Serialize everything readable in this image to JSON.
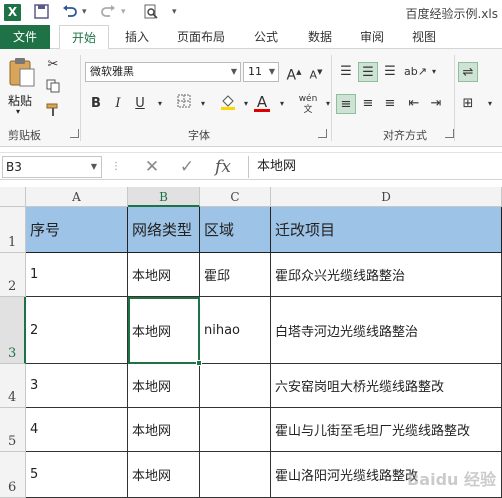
{
  "title_bar": {
    "app_logo": "X",
    "document_title": "百度经验示例.xls"
  },
  "ribbon_tabs": [
    "文件",
    "开始",
    "插入",
    "页面布局",
    "公式",
    "数据",
    "审阅",
    "视图"
  ],
  "active_tab": "开始",
  "ribbon": {
    "clipboard": {
      "paste_label": "粘贴",
      "group_label": "剪贴板"
    },
    "font": {
      "font_name": "微软雅黑",
      "font_size": "11",
      "bold": "B",
      "italic": "I",
      "underline": "U",
      "group_label": "字体",
      "grow": "A",
      "shrink": "A",
      "font_color_letter": "A",
      "phonetic": "wén"
    },
    "alignment": {
      "group_label": "对齐方式"
    }
  },
  "formula_bar": {
    "name_box": "B3",
    "fx_label": "fx",
    "formula": "本地网"
  },
  "sheet": {
    "columns": [
      "A",
      "B",
      "C",
      "D"
    ],
    "selected_column": "B",
    "selected_row": "3",
    "rows": [
      {
        "num": "1",
        "cells": [
          "序号",
          "网络类型",
          "区域",
          "迁改项目"
        ]
      },
      {
        "num": "2",
        "cells": [
          "1",
          "本地网",
          "霍邱",
          "霍邱众兴光缆线路整治"
        ]
      },
      {
        "num": "3",
        "cells": [
          "2",
          "本地网",
          "nihao",
          "白塔寺河边光缆线路整治"
        ]
      },
      {
        "num": "4",
        "cells": [
          "3",
          "本地网",
          "",
          "六安窑岗咀大桥光缆线路整改"
        ]
      },
      {
        "num": "5",
        "cells": [
          "4",
          "本地网",
          "",
          "霍山与儿街至毛坦厂光缆线路整改"
        ]
      },
      {
        "num": "6",
        "cells": [
          "5",
          "本地网",
          "",
          "霍山洛阳河光缆线路整改"
        ]
      }
    ]
  },
  "watermark": "Baidu 经验",
  "colors": {
    "accent": "#1f7246",
    "header_fill": "#9dc3e6"
  }
}
